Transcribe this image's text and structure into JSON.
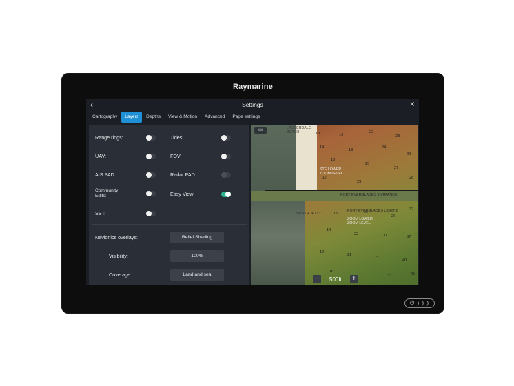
{
  "brand": "Raymarine",
  "header": {
    "title": "Settings",
    "back_icon": "chevron-left-icon",
    "close_icon": "close-icon"
  },
  "tabs": [
    {
      "label": "Cartography"
    },
    {
      "label": "Layers",
      "active": true
    },
    {
      "label": "Depths"
    },
    {
      "label": "View & Motion"
    },
    {
      "label": "Advanced"
    },
    {
      "label": "Page settings"
    }
  ],
  "layers": {
    "range_rings": {
      "label": "Range rings:",
      "on": false
    },
    "tides": {
      "label": "Tides:",
      "on": false
    },
    "uav": {
      "label": "UAV:",
      "on": false
    },
    "fov": {
      "label": "FOV:",
      "on": false
    },
    "ais_pad": {
      "label": "AIS PAD:",
      "on": false
    },
    "radar_pad": {
      "label": "Radar PAD:",
      "on": false,
      "disabled": true
    },
    "community_edits": {
      "label": "Community\nEdits:",
      "on": false
    },
    "easy_view": {
      "label": "Easy View:",
      "on": true
    },
    "sst": {
      "label": "SST:",
      "on": false
    }
  },
  "navionics": {
    "overlays_label": "Navionics overlays:",
    "overlays_value": "Relief Shading",
    "visibility_label": "Visibility:",
    "visibility_value": "100%",
    "coverage_label": "Coverage:",
    "coverage_value": "Land and sea"
  },
  "map": {
    "labels": {
      "lauderdale": "LAUDERDALE\nBEACH",
      "ste_lower": "STE LOWER\nZOOM LEVEL",
      "port_entrance": "PORT EVERGLADES ENTRANCE",
      "south_jetty": "SOUTH JETTY",
      "port_light": "PORT EVERGLADES LIGHT 2",
      "zoom_lower": "ZOOM LOWER\nZOOM LEVEL"
    },
    "scale": "500ft",
    "zoom_out": "−",
    "zoom_in": "+"
  },
  "colors": {
    "accent": "#1f8fd6",
    "toggle_on": "#2bb28a"
  },
  "power_icons": "power-and-brightness-icons"
}
